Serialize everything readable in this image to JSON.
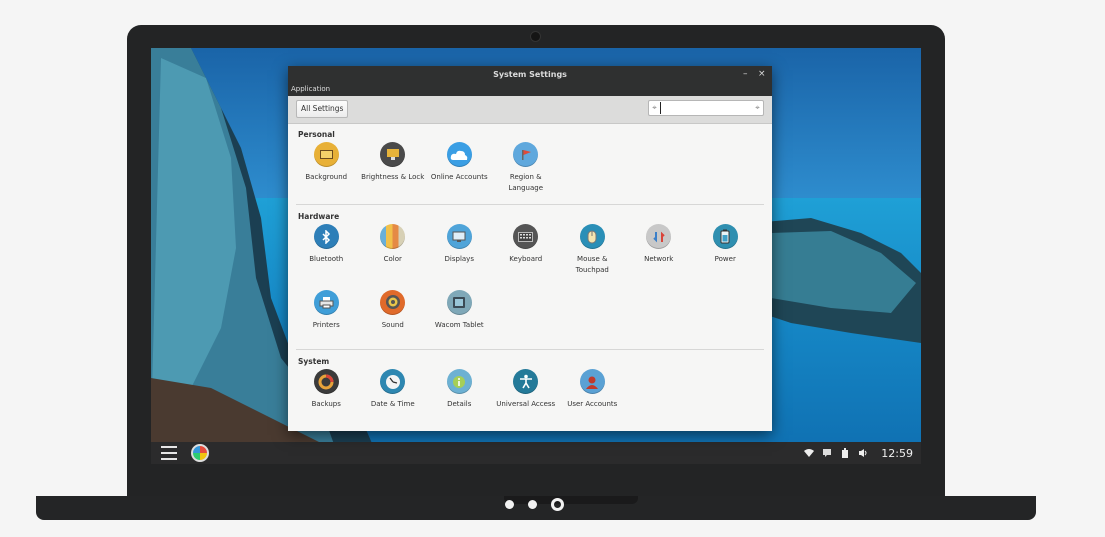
{
  "window": {
    "title": "System Settings",
    "app_menu": "Application",
    "minimize": "–",
    "close": "×"
  },
  "toolbar": {
    "all_settings_label": "All Settings",
    "search_value": ""
  },
  "sections": {
    "personal": {
      "title": "Personal",
      "items": [
        {
          "label": "Background",
          "icon": "background-icon",
          "color": "#e8b036"
        },
        {
          "label": "Brightness & Lock",
          "icon": "brightness-lock-icon",
          "color": "#4a4a4a"
        },
        {
          "label": "Online Accounts",
          "icon": "online-accounts-icon",
          "color": "#3a9ee4"
        },
        {
          "label": "Region & Language",
          "icon": "region-language-icon",
          "color": "#5fa8dd"
        }
      ]
    },
    "hardware": {
      "title": "Hardware",
      "items": [
        {
          "label": "Bluetooth",
          "icon": "bluetooth-icon",
          "color": "#2e7fb8"
        },
        {
          "label": "Color",
          "icon": "color-icon",
          "color": "#e5a64a"
        },
        {
          "label": "Displays",
          "icon": "displays-icon",
          "color": "#4fa4d9"
        },
        {
          "label": "Keyboard",
          "icon": "keyboard-icon",
          "color": "#555555"
        },
        {
          "label": "Mouse & Touchpad",
          "icon": "mouse-touchpad-icon",
          "color": "#2a8fb7"
        },
        {
          "label": "Network",
          "icon": "network-icon",
          "color": "#c8c8c8"
        },
        {
          "label": "Power",
          "icon": "power-icon",
          "color": "#2f8fb0"
        },
        {
          "label": "Printers",
          "icon": "printers-icon",
          "color": "#3f9ed8"
        },
        {
          "label": "Sound",
          "icon": "sound-icon",
          "color": "#e06a2a"
        },
        {
          "label": "Wacom Tablet",
          "icon": "wacom-tablet-icon",
          "color": "#7fa8b8"
        }
      ]
    },
    "system": {
      "title": "System",
      "items": [
        {
          "label": "Backups",
          "icon": "backups-icon",
          "color": "#3b3b3b"
        },
        {
          "label": "Date & Time",
          "icon": "date-time-icon",
          "color": "#2e87b1"
        },
        {
          "label": "Details",
          "icon": "details-icon",
          "color": "#6db1d3"
        },
        {
          "label": "Universal Access",
          "icon": "universal-access-icon",
          "color": "#247a99"
        },
        {
          "label": "User Accounts",
          "icon": "user-accounts-icon",
          "color": "#5aa1d4"
        }
      ]
    }
  },
  "taskbar": {
    "clock": "12:59"
  },
  "pager": {
    "count": 3,
    "active": 3
  }
}
